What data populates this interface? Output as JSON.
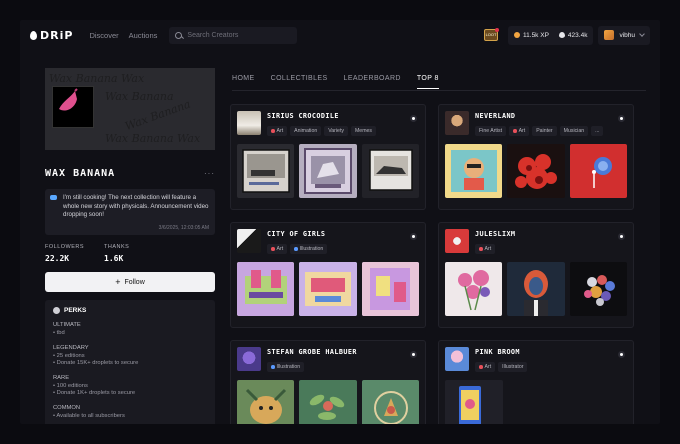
{
  "topbar": {
    "logo": "DRiP",
    "nav": [
      "Discover",
      "Auctions"
    ],
    "search_placeholder": "Search Creators",
    "xp": "11.5k XP",
    "droplets": "423.4k",
    "username": "vibhu",
    "badge_text": "LOOT"
  },
  "profile": {
    "name": "WAX BANANA",
    "more": "···",
    "status_text": "I'm still cooking! The next collection will feature a whole new story with physicals. Announcement video dropping soon!",
    "status_time": "3/6/2025, 12:03:05 AM",
    "followers_label": "FOLLOWERS",
    "followers_value": "22.2K",
    "thanks_label": "THANKS",
    "thanks_value": "1.6K",
    "follow_label": "Follow",
    "banner_text": "Wax Banana"
  },
  "perks": {
    "title": "PERKS",
    "tiers": [
      {
        "name": "ULTIMATE",
        "items": [
          "• tbd"
        ]
      },
      {
        "name": "LEGENDARY",
        "items": [
          "• 25 editions",
          "• Donate 15K+ droplets to secure"
        ]
      },
      {
        "name": "RARE",
        "items": [
          "• 100 editions",
          "• Donate 1K+ droplets to secure"
        ]
      },
      {
        "name": "COMMON",
        "items": [
          "• Available to all subscribers"
        ]
      }
    ]
  },
  "tabs": [
    "HOME",
    "COLLECTIBLES",
    "LEADERBOARD",
    "TOP 8"
  ],
  "cards": [
    {
      "title": "SIRIUS CROCODILE",
      "tags": [
        "Art",
        "Animation",
        "Variety",
        "Memes"
      ]
    },
    {
      "title": "NEVERLAND",
      "tags": [
        "Fine Artist",
        "Art",
        "Painter",
        "Musician",
        "..."
      ]
    },
    {
      "title": "CITY OF GIRLS",
      "tags": [
        "Art",
        "Illustration"
      ]
    },
    {
      "title": "JULESLIXM",
      "tags": [
        "Art"
      ]
    },
    {
      "title": "STEFAN GROBE HALBUER",
      "tags": [
        "Illustration"
      ]
    },
    {
      "title": "PINK BROOM",
      "tags": [
        "Art",
        "Illustrator"
      ]
    }
  ],
  "colors": {
    "accent_pink": "#e0508e",
    "tag_art": "#e8505a",
    "tag_illustration": "#5a9aff",
    "xp_icon": "#f2a541"
  }
}
